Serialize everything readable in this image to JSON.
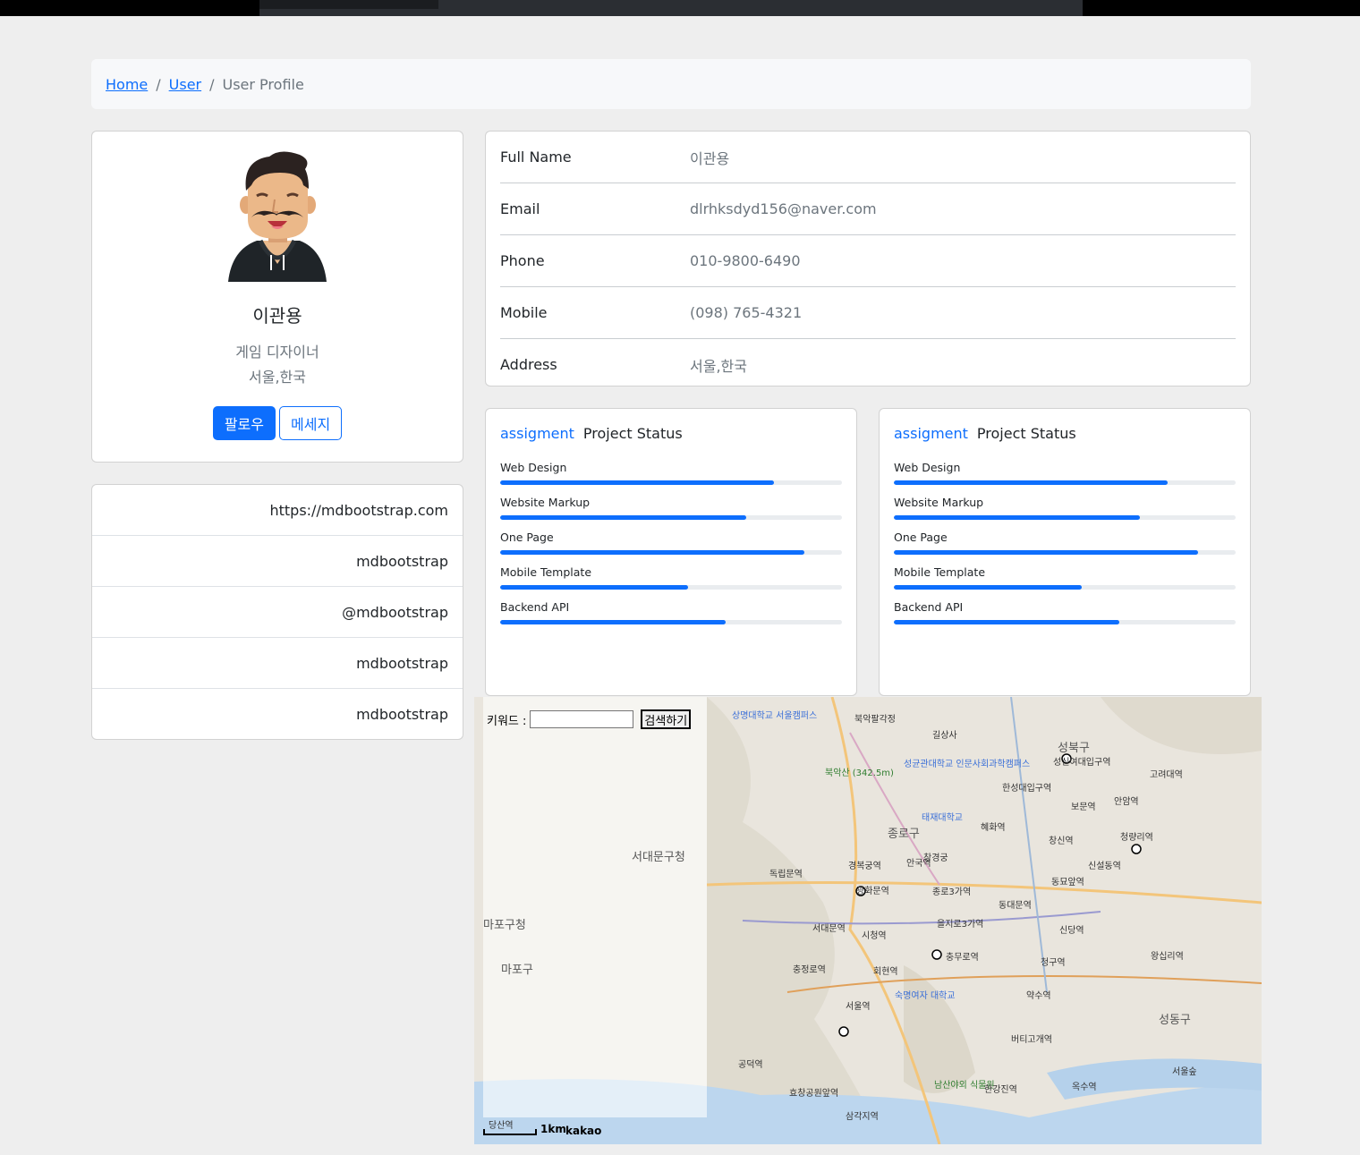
{
  "breadcrumb": {
    "home": "Home",
    "user": "User",
    "current": "User Profile"
  },
  "profile": {
    "name": "이관용",
    "role": "게임 디자이너",
    "location": "서울,한국",
    "follow_label": "팔로우",
    "message_label": "메세지"
  },
  "links": [
    {
      "text": "https://mdbootstrap.com"
    },
    {
      "text": "mdbootstrap"
    },
    {
      "text": "@mdbootstrap"
    },
    {
      "text": "mdbootstrap"
    },
    {
      "text": "mdbootstrap"
    }
  ],
  "info": [
    {
      "label": "Full Name",
      "value": "이관용"
    },
    {
      "label": "Email",
      "value": "dlrhksdyd156@naver.com"
    },
    {
      "label": "Phone",
      "value": "010-9800-6490"
    },
    {
      "label": "Mobile",
      "value": "(098) 765-4321"
    },
    {
      "label": "Address",
      "value": "서울,한국"
    }
  ],
  "projects": [
    {
      "accent": "assigment",
      "title": "Project Status",
      "items": [
        {
          "label": "Web Design",
          "progress": 0.8
        },
        {
          "label": "Website Markup",
          "progress": 0.72
        },
        {
          "label": "One Page",
          "progress": 0.89
        },
        {
          "label": "Mobile Template",
          "progress": 0.55
        },
        {
          "label": "Backend API",
          "progress": 0.66
        }
      ]
    },
    {
      "accent": "assigment",
      "title": "Project Status",
      "items": [
        {
          "label": "Web Design",
          "progress": 0.8
        },
        {
          "label": "Website Markup",
          "progress": 0.72
        },
        {
          "label": "One Page",
          "progress": 0.89
        },
        {
          "label": "Mobile Template",
          "progress": 0.55
        },
        {
          "label": "Backend API",
          "progress": 0.66
        }
      ]
    }
  ],
  "map": {
    "search_label": "키워드 :",
    "search_value": "",
    "search_button": "검색하기",
    "scale": "1km",
    "brand": "kakao",
    "places": [
      {
        "text": "상명대학교 서울캠퍼스",
        "cls": "blue"
      },
      {
        "text": "북악팔각정",
        "cls": ""
      },
      {
        "text": "길상사",
        "cls": ""
      },
      {
        "text": "성북구",
        "cls": "big"
      },
      {
        "text": "성신여대입구역",
        "cls": ""
      },
      {
        "text": "북악산 (342.5m)",
        "cls": "green"
      },
      {
        "text": "성균관대학교 인문사회과학캠퍼스",
        "cls": "blue"
      },
      {
        "text": "한성대입구역",
        "cls": ""
      },
      {
        "text": "고려대역",
        "cls": ""
      },
      {
        "text": "보문역",
        "cls": ""
      },
      {
        "text": "안암역",
        "cls": ""
      },
      {
        "text": "태재대학교",
        "cls": "blue"
      },
      {
        "text": "종로구",
        "cls": "big"
      },
      {
        "text": "혜화역",
        "cls": ""
      },
      {
        "text": "창신역",
        "cls": ""
      },
      {
        "text": "청량리역",
        "cls": ""
      },
      {
        "text": "서대문구청",
        "cls": "big"
      },
      {
        "text": "창경궁",
        "cls": ""
      },
      {
        "text": "경복궁역",
        "cls": ""
      },
      {
        "text": "안국역",
        "cls": ""
      },
      {
        "text": "신설동역",
        "cls": ""
      },
      {
        "text": "독립문역",
        "cls": ""
      },
      {
        "text": "광화문역",
        "cls": ""
      },
      {
        "text": "종로3가역",
        "cls": ""
      },
      {
        "text": "동묘앞역",
        "cls": ""
      },
      {
        "text": "동대문역",
        "cls": ""
      },
      {
        "text": "마포구청",
        "cls": "big"
      },
      {
        "text": "서대문역",
        "cls": ""
      },
      {
        "text": "을지로3가역",
        "cls": ""
      },
      {
        "text": "신당역",
        "cls": ""
      },
      {
        "text": "시청역",
        "cls": ""
      },
      {
        "text": "충무로역",
        "cls": ""
      },
      {
        "text": "청구역",
        "cls": ""
      },
      {
        "text": "왕십리역",
        "cls": ""
      },
      {
        "text": "마포구",
        "cls": "big"
      },
      {
        "text": "충정로역",
        "cls": ""
      },
      {
        "text": "회현역",
        "cls": ""
      },
      {
        "text": "약수역",
        "cls": ""
      },
      {
        "text": "서울역",
        "cls": ""
      },
      {
        "text": "숙명여자 대학교",
        "cls": "blue"
      },
      {
        "text": "공덕역",
        "cls": ""
      },
      {
        "text": "버티고개역",
        "cls": ""
      },
      {
        "text": "성동구",
        "cls": "big"
      },
      {
        "text": "효창공원앞역",
        "cls": ""
      },
      {
        "text": "남산야외 식물원",
        "cls": "green"
      },
      {
        "text": "한강진역",
        "cls": ""
      },
      {
        "text": "옥수역",
        "cls": ""
      },
      {
        "text": "삼각지역",
        "cls": ""
      },
      {
        "text": "당산역",
        "cls": ""
      },
      {
        "text": "서울숲",
        "cls": ""
      }
    ]
  }
}
